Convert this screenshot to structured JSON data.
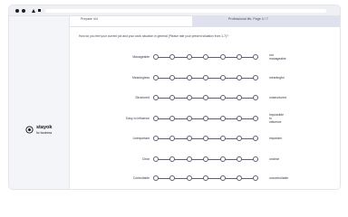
{
  "tabs": {
    "left_label": "Prepare 4/4",
    "right_label": "Professional life, Page 4 / 7"
  },
  "brand": {
    "name": "stayok",
    "subtitle": "for business"
  },
  "survey": {
    "question": "How do you feel your current job and your work situation in general (Please rate your present situation from 1-7)?",
    "rows": [
      {
        "left": "Manageable",
        "right": [
          "not",
          "manageable"
        ]
      },
      {
        "left": "Meaningless",
        "right": [
          "meaningful"
        ]
      },
      {
        "left": "Structured",
        "right": [
          "unstructured"
        ]
      },
      {
        "left": "Easy to influence",
        "right": [
          "impossible",
          "to",
          "influence"
        ]
      },
      {
        "left": "Unimportant",
        "right": [
          "important"
        ]
      },
      {
        "left": "Clear",
        "right": [
          "unclear"
        ]
      },
      {
        "left": "Controllable",
        "right": [
          "uncontrollable"
        ]
      }
    ]
  }
}
